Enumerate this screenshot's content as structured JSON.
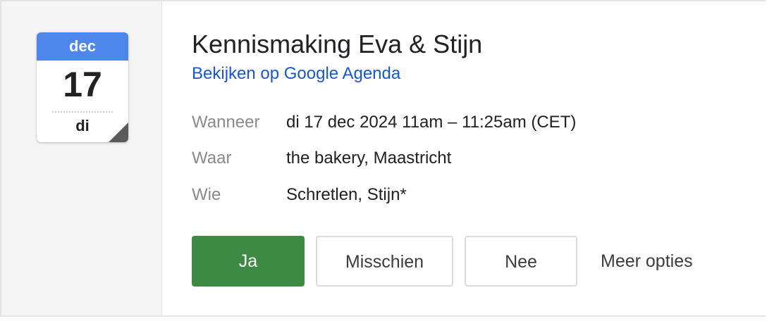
{
  "calendar_icon": {
    "month": "dec",
    "day": "17",
    "weekday": "di",
    "header_color": "#4f86ec"
  },
  "event": {
    "title": "Kennismaking Eva & Stijn",
    "view_link": "Bekijken op Google Agenda",
    "details": {
      "when_label": "Wanneer",
      "when_value": "di 17 dec 2024 11am – 11:25am (CET)",
      "where_label": "Waar",
      "where_value": "the bakery, Maastricht",
      "who_label": "Wie",
      "who_value": "Schretlen, Stijn*"
    }
  },
  "rsvp": {
    "yes_label": "Ja",
    "maybe_label": "Misschien",
    "no_label": "Nee",
    "more_label": "Meer opties",
    "yes_color": "#3d8a45",
    "link_color": "#1a57c8"
  }
}
